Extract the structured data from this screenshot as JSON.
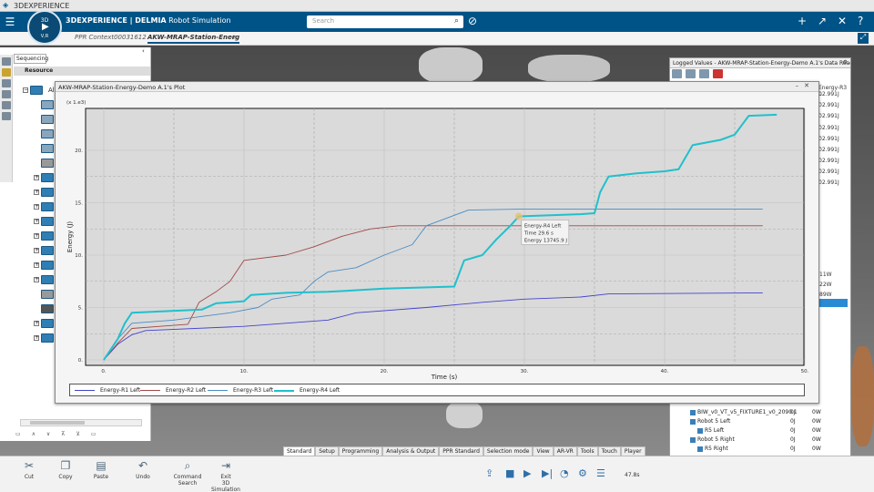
{
  "os_bar": {
    "title": "3DEXPERIENCE"
  },
  "header": {
    "brand": "3DEXPERIENCE | DELMIA",
    "app": "Robot Simulation",
    "search_placeholder": "Search",
    "compass_top": "3D",
    "compass_bottom": "V,R"
  },
  "tabs": [
    {
      "label": "PPR Context00031612"
    },
    {
      "label": "AKW-MRAP-Station-Energ"
    },
    {
      "label": "+"
    }
  ],
  "left_panel": {
    "tab": "Sequencing",
    "resource_header": "Resource",
    "root_label": "Al"
  },
  "data_reader": {
    "title": "Logged Values - AKW-MRAP-Station-Energy-Demo A.1's Data Reader",
    "header_fragment": "Energy-R3 L",
    "values": [
      "02.991J",
      "02.991J",
      "02.991J",
      "02.991J",
      "02.991J",
      "02.991J",
      "02.991J",
      "02.991J",
      "02.991J"
    ],
    "watts": [
      "11W",
      "22W",
      "89W"
    ],
    "rows": [
      {
        "label": "BIW_v0_VT_v5_FIXTURE1_v0_2090.1",
        "a": "0J",
        "b": "0W"
      },
      {
        "label": "Robot 5 Left",
        "a": "0J",
        "b": "0W"
      },
      {
        "label": "R5 Left",
        "a": "0J",
        "b": "0W"
      },
      {
        "label": "Robot 5 Right",
        "a": "0J",
        "b": "0W"
      },
      {
        "label": "R5 Right",
        "a": "0J",
        "b": "0W"
      }
    ]
  },
  "plot": {
    "window_title": "AKW-MRAP-Station-Energy-Demo A.1's Plot",
    "tooltip": [
      "Energy-R4 Left",
      "Time 29.6 s",
      "Energy 13745.9 J"
    ]
  },
  "chart_data": {
    "type": "line",
    "title": "",
    "xlabel": "Time (s)",
    "ylabel": "Energy (J)",
    "y_multiplier_label": "(x 1.e3)",
    "xlim": [
      0,
      50
    ],
    "ylim": [
      0,
      24
    ],
    "x_ticks": [
      "0.",
      "10.",
      "20.",
      "30.",
      "40.",
      "50."
    ],
    "y_ticks": [
      "0.",
      "5.",
      "10.",
      "15.",
      "20."
    ],
    "grid": true,
    "legend_position": "bottom",
    "series": [
      {
        "name": "Energy-R1 Left",
        "color": "#4444cc",
        "points": [
          [
            0,
            0
          ],
          [
            1,
            1.5
          ],
          [
            2,
            2.4
          ],
          [
            3,
            2.8
          ],
          [
            10,
            3.2
          ],
          [
            16,
            3.8
          ],
          [
            18,
            4.5
          ],
          [
            23,
            5
          ],
          [
            27,
            5.5
          ],
          [
            30,
            5.8
          ],
          [
            34,
            6
          ],
          [
            36,
            6.3
          ],
          [
            47,
            6.4
          ]
        ]
      },
      {
        "name": "Energy-R2 Left",
        "color": "#a04848",
        "points": [
          [
            0,
            0
          ],
          [
            1,
            1.6
          ],
          [
            2,
            3
          ],
          [
            4,
            3.2
          ],
          [
            6,
            3.4
          ],
          [
            6.8,
            5.5
          ],
          [
            8,
            6.5
          ],
          [
            9,
            7.5
          ],
          [
            10,
            9.5
          ],
          [
            13,
            10
          ],
          [
            15,
            10.8
          ],
          [
            17,
            11.8
          ],
          [
            19,
            12.5
          ],
          [
            21,
            12.8
          ],
          [
            47,
            12.8
          ]
        ]
      },
      {
        "name": "Energy-R3 Left",
        "color": "#4a8cc4",
        "points": [
          [
            0,
            0
          ],
          [
            1,
            2
          ],
          [
            2,
            3.5
          ],
          [
            5,
            3.8
          ],
          [
            9,
            4.5
          ],
          [
            11,
            5
          ],
          [
            12,
            5.8
          ],
          [
            14,
            6.2
          ],
          [
            15,
            7.5
          ],
          [
            16,
            8.4
          ],
          [
            18,
            8.8
          ],
          [
            20,
            10
          ],
          [
            22,
            11
          ],
          [
            23,
            12.8
          ],
          [
            25,
            13.8
          ],
          [
            26,
            14.3
          ],
          [
            30,
            14.4
          ],
          [
            47,
            14.4
          ]
        ]
      },
      {
        "name": "Energy-R4 Left",
        "color": "#20c0cc",
        "points": [
          [
            0,
            0
          ],
          [
            1,
            2
          ],
          [
            1.5,
            3.5
          ],
          [
            2,
            4.5
          ],
          [
            7,
            4.8
          ],
          [
            8,
            5.4
          ],
          [
            10,
            5.6
          ],
          [
            10.5,
            6.2
          ],
          [
            13,
            6.4
          ],
          [
            16,
            6.5
          ],
          [
            20,
            6.8
          ],
          [
            25,
            7
          ],
          [
            25.7,
            9.5
          ],
          [
            27,
            10
          ],
          [
            28,
            11.5
          ],
          [
            29,
            12.8
          ],
          [
            29.6,
            13.7
          ],
          [
            34,
            13.9
          ],
          [
            35,
            14
          ],
          [
            35.4,
            16
          ],
          [
            36,
            17.5
          ],
          [
            38,
            17.8
          ],
          [
            40,
            18
          ],
          [
            41,
            18.2
          ],
          [
            42,
            20.5
          ],
          [
            44,
            21
          ],
          [
            45,
            21.5
          ],
          [
            46,
            23.3
          ],
          [
            48,
            23.4
          ]
        ]
      }
    ]
  },
  "bottom_tabs": [
    "Standard",
    "Setup",
    "Programming",
    "Analysis & Output",
    "PPR Standard",
    "Selection mode",
    "View",
    "AR-VR",
    "Tools",
    "Touch",
    "Player"
  ],
  "actions": {
    "cut": "Cut",
    "copy": "Copy",
    "paste": "Paste",
    "undo": "Undo",
    "command_search_1": "Command",
    "command_search_2": "Search",
    "exit_sim_1": "Exit",
    "exit_sim_2": "3D Simulation"
  },
  "player": {
    "time": "47.8s"
  }
}
